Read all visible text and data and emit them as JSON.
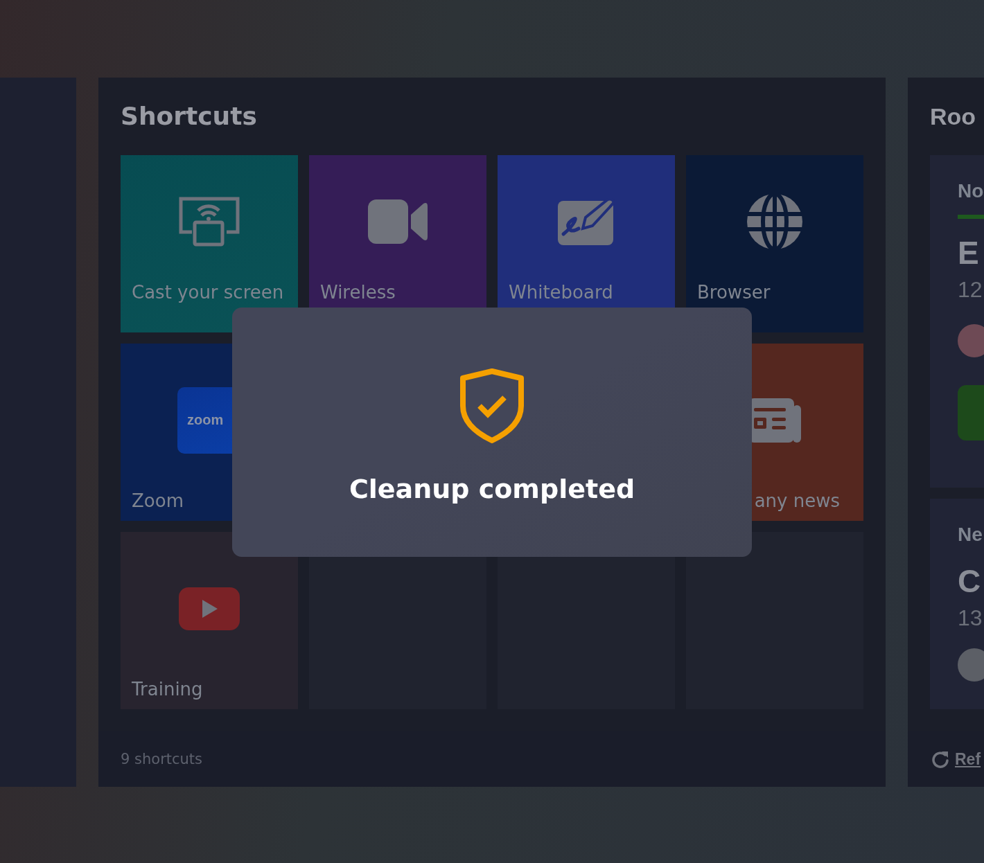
{
  "main_panel": {
    "title": "Shortcuts",
    "tiles": [
      {
        "kind": "cast",
        "label": "Cast your screen"
      },
      {
        "kind": "video",
        "label": "Wireless"
      },
      {
        "kind": "whiteboard",
        "label": "Whiteboard"
      },
      {
        "kind": "browser",
        "label": "Browser"
      },
      {
        "kind": "zoom",
        "label": "Zoom",
        "logo": "zoom"
      },
      {
        "kind": "news",
        "label": "any news"
      },
      {
        "kind": "play",
        "label": "Training"
      },
      {
        "kind": "empty"
      },
      {
        "kind": "empty"
      },
      {
        "kind": "empty"
      }
    ],
    "footer": "9 shortcuts"
  },
  "side_panel": {
    "title": "Roo",
    "cards": [
      {
        "heading": "No",
        "underlined": true,
        "title": "E",
        "time": "12",
        "button": true
      },
      {
        "heading": "Ne",
        "underlined": false,
        "title": "C",
        "time": "13",
        "button": false
      }
    ],
    "footer_link": "Ref"
  },
  "dialog": {
    "message": "Cleanup completed"
  }
}
